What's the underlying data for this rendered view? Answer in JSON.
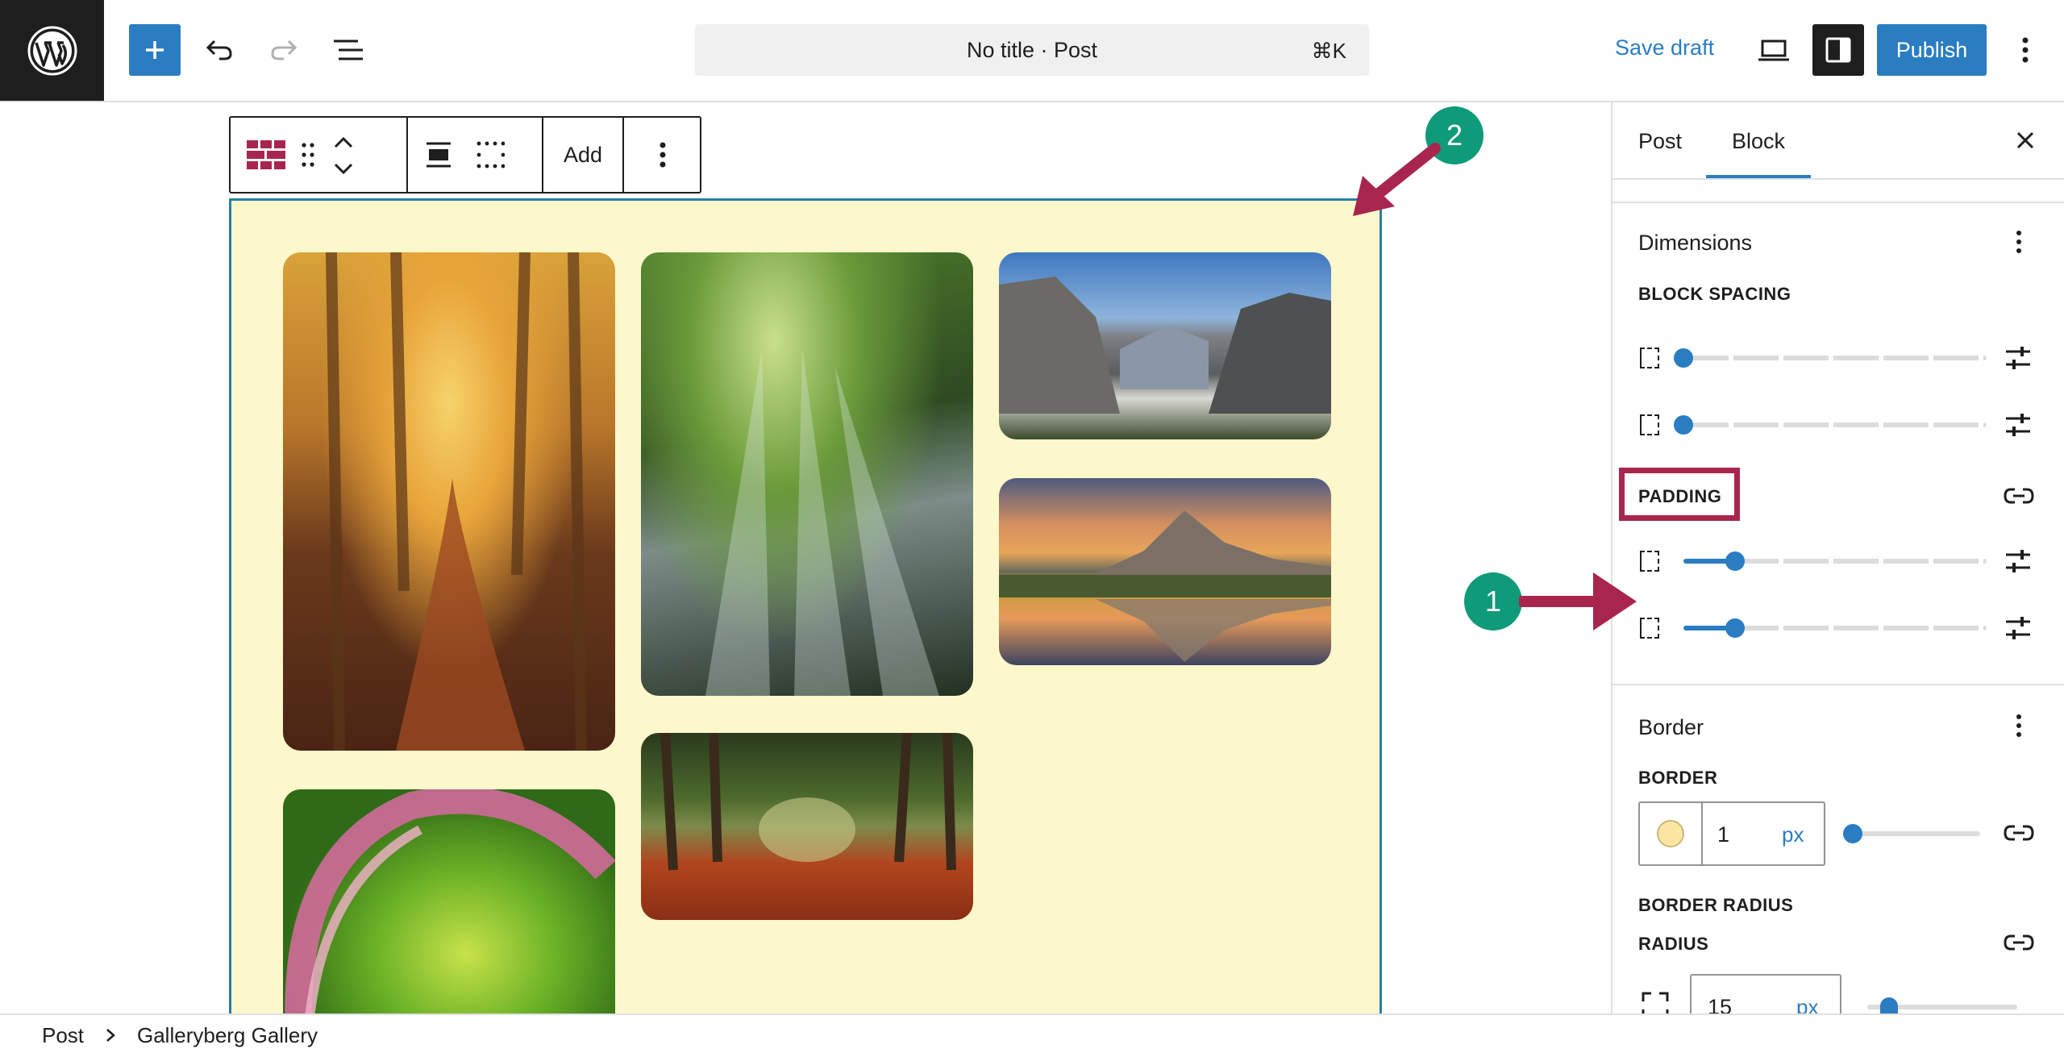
{
  "header": {
    "title": "No title · Post",
    "shortcut": "⌘K",
    "save_draft": "Save draft",
    "publish": "Publish"
  },
  "block_toolbar": {
    "add_label": "Add"
  },
  "sidebar": {
    "tabs": [
      "Post",
      "Block"
    ],
    "active_tab": "Block",
    "dimensions": {
      "heading": "Dimensions",
      "block_spacing_label": "BLOCK SPACING",
      "padding_label": "PADDING"
    },
    "border": {
      "heading": "Border",
      "border_label": "BORDER",
      "border_width": "1",
      "border_unit": "px",
      "border_color": "#fde5a3",
      "border_radius_label": "BORDER RADIUS",
      "radius_label": "RADIUS",
      "radius_value": "15",
      "radius_unit": "px"
    }
  },
  "annotations": {
    "badge_1": "1",
    "badge_2": "2"
  },
  "breadcrumb": {
    "root": "Post",
    "current": "Galleryberg Gallery"
  },
  "colors": {
    "accent": "#2b7dc2",
    "badge": "#0f9a7a",
    "highlight": "#a8264e",
    "gallery_bg": "#fdf7cc"
  }
}
